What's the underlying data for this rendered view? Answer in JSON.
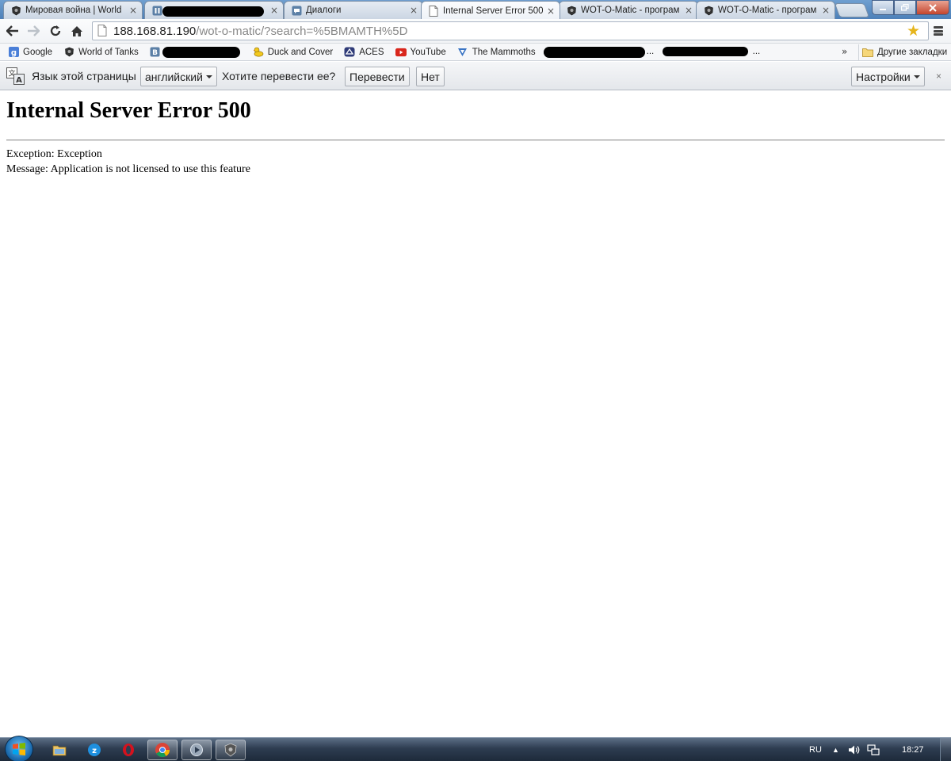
{
  "tabs": [
    {
      "title": "Мировая война | World",
      "icon": "world-of-tanks-icon",
      "active": false
    },
    {
      "title": "",
      "icon": "vk-icon",
      "active": false
    },
    {
      "title": "Диалоги",
      "icon": "chat-icon",
      "active": false
    },
    {
      "title": "Internal Server Error 500",
      "icon": "page-icon",
      "active": true
    },
    {
      "title": "WOT-O-Matic - програм",
      "icon": "world-of-tanks-icon",
      "active": false
    },
    {
      "title": "WOT-O-Matic - програм",
      "icon": "world-of-tanks-icon",
      "active": false
    }
  ],
  "tab_close_glyph": "×",
  "address": {
    "host": "188.168.81.190",
    "path": "/wot-o-matic/?search=%5BMAMTH%5D"
  },
  "bookmarks": [
    {
      "label": "Google",
      "icon": "google-icon"
    },
    {
      "label": "World of Tanks",
      "icon": "world-of-tanks-icon"
    },
    {
      "label": "",
      "icon": "vk-icon"
    },
    {
      "label": "Duck and Cover",
      "icon": "duck-icon"
    },
    {
      "label": "ACES",
      "icon": "aces-icon"
    },
    {
      "label": "YouTube",
      "icon": "youtube-icon"
    },
    {
      "label": "The Mammoths",
      "icon": "mammoths-icon"
    }
  ],
  "bookmarks_ellipsis": "...",
  "bookmarks_more": "»",
  "other_bookmarks": "Другие закладки",
  "translate": {
    "lang_prompt": "Язык этой страницы",
    "language": "английский",
    "question": "Хотите перевести ее?",
    "translate_button": "Перевести",
    "no_button": "Нет",
    "settings_button": "Настройки",
    "close_glyph": "×"
  },
  "page": {
    "title": "Internal Server Error 500",
    "exception_line": "Exception: Exception",
    "message_line": "Message: Application is not licensed to use this feature"
  },
  "taskbar": {
    "apps": [
      "explorer-icon",
      "zona-icon",
      "opera-icon",
      "chrome-icon",
      "media-icon",
      "world-of-tanks-icon"
    ],
    "language": "RU",
    "time": "18:27"
  },
  "colors": {
    "youtube_red": "#d9261c",
    "star_yellow": "#e6b51c",
    "google_blue": "#4a7fd8"
  }
}
